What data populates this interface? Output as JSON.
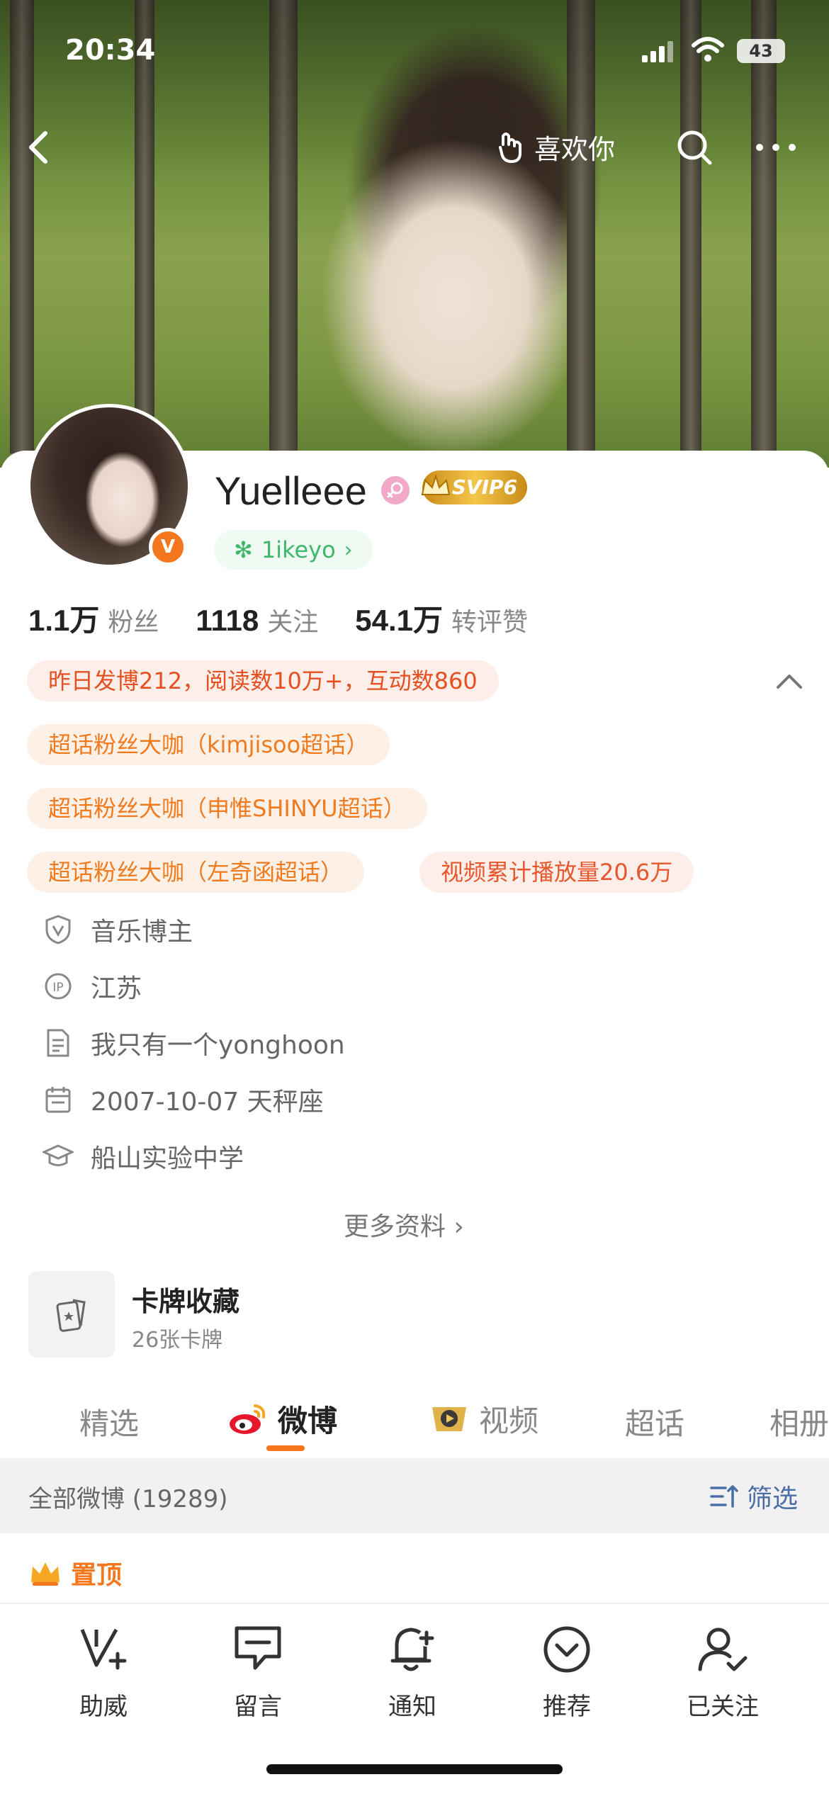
{
  "status": {
    "time": "20:34",
    "battery": "43"
  },
  "nav": {
    "like_label": "喜欢你"
  },
  "profile": {
    "name": "Yuelleee",
    "svip": "SVIP6",
    "handle": "1ikeyo",
    "stats": [
      {
        "value": "1.1万",
        "label": "粉丝"
      },
      {
        "value": "1118",
        "label": "关注"
      },
      {
        "value": "54.1万",
        "label": "转评赞"
      }
    ]
  },
  "tags": {
    "yesterday": "昨日发博212，阅读数10万+，互动数860",
    "fan1": "超话粉丝大咖（kimjisoo超话）",
    "fan2": "超话粉丝大咖（申惟SHINYU超话）",
    "fan3": "超话粉丝大咖（左奇函超话）",
    "video_plays": "视频累计播放量20.6万"
  },
  "info": {
    "category": "音乐博主",
    "ip": "江苏",
    "bio": "我只有一个yonghoon",
    "birthday": "2007-10-07 天秤座",
    "school": "船山实验中学"
  },
  "more_info": "更多资料",
  "card_collection": {
    "title": "卡牌收藏",
    "subtitle": "26张卡牌"
  },
  "tabs": [
    "精选",
    "微博",
    "视频",
    "超话",
    "相册"
  ],
  "feed": {
    "all_label": "全部微博 (19289)",
    "filter_label": "筛选",
    "pinned_label": "置顶"
  },
  "bottom_bar": [
    "助威",
    "留言",
    "通知",
    "推荐",
    "已关注"
  ],
  "colors": {
    "accent": "#f5771d",
    "link_blue": "#4a6fa5",
    "handle_green": "#3fb86a"
  }
}
